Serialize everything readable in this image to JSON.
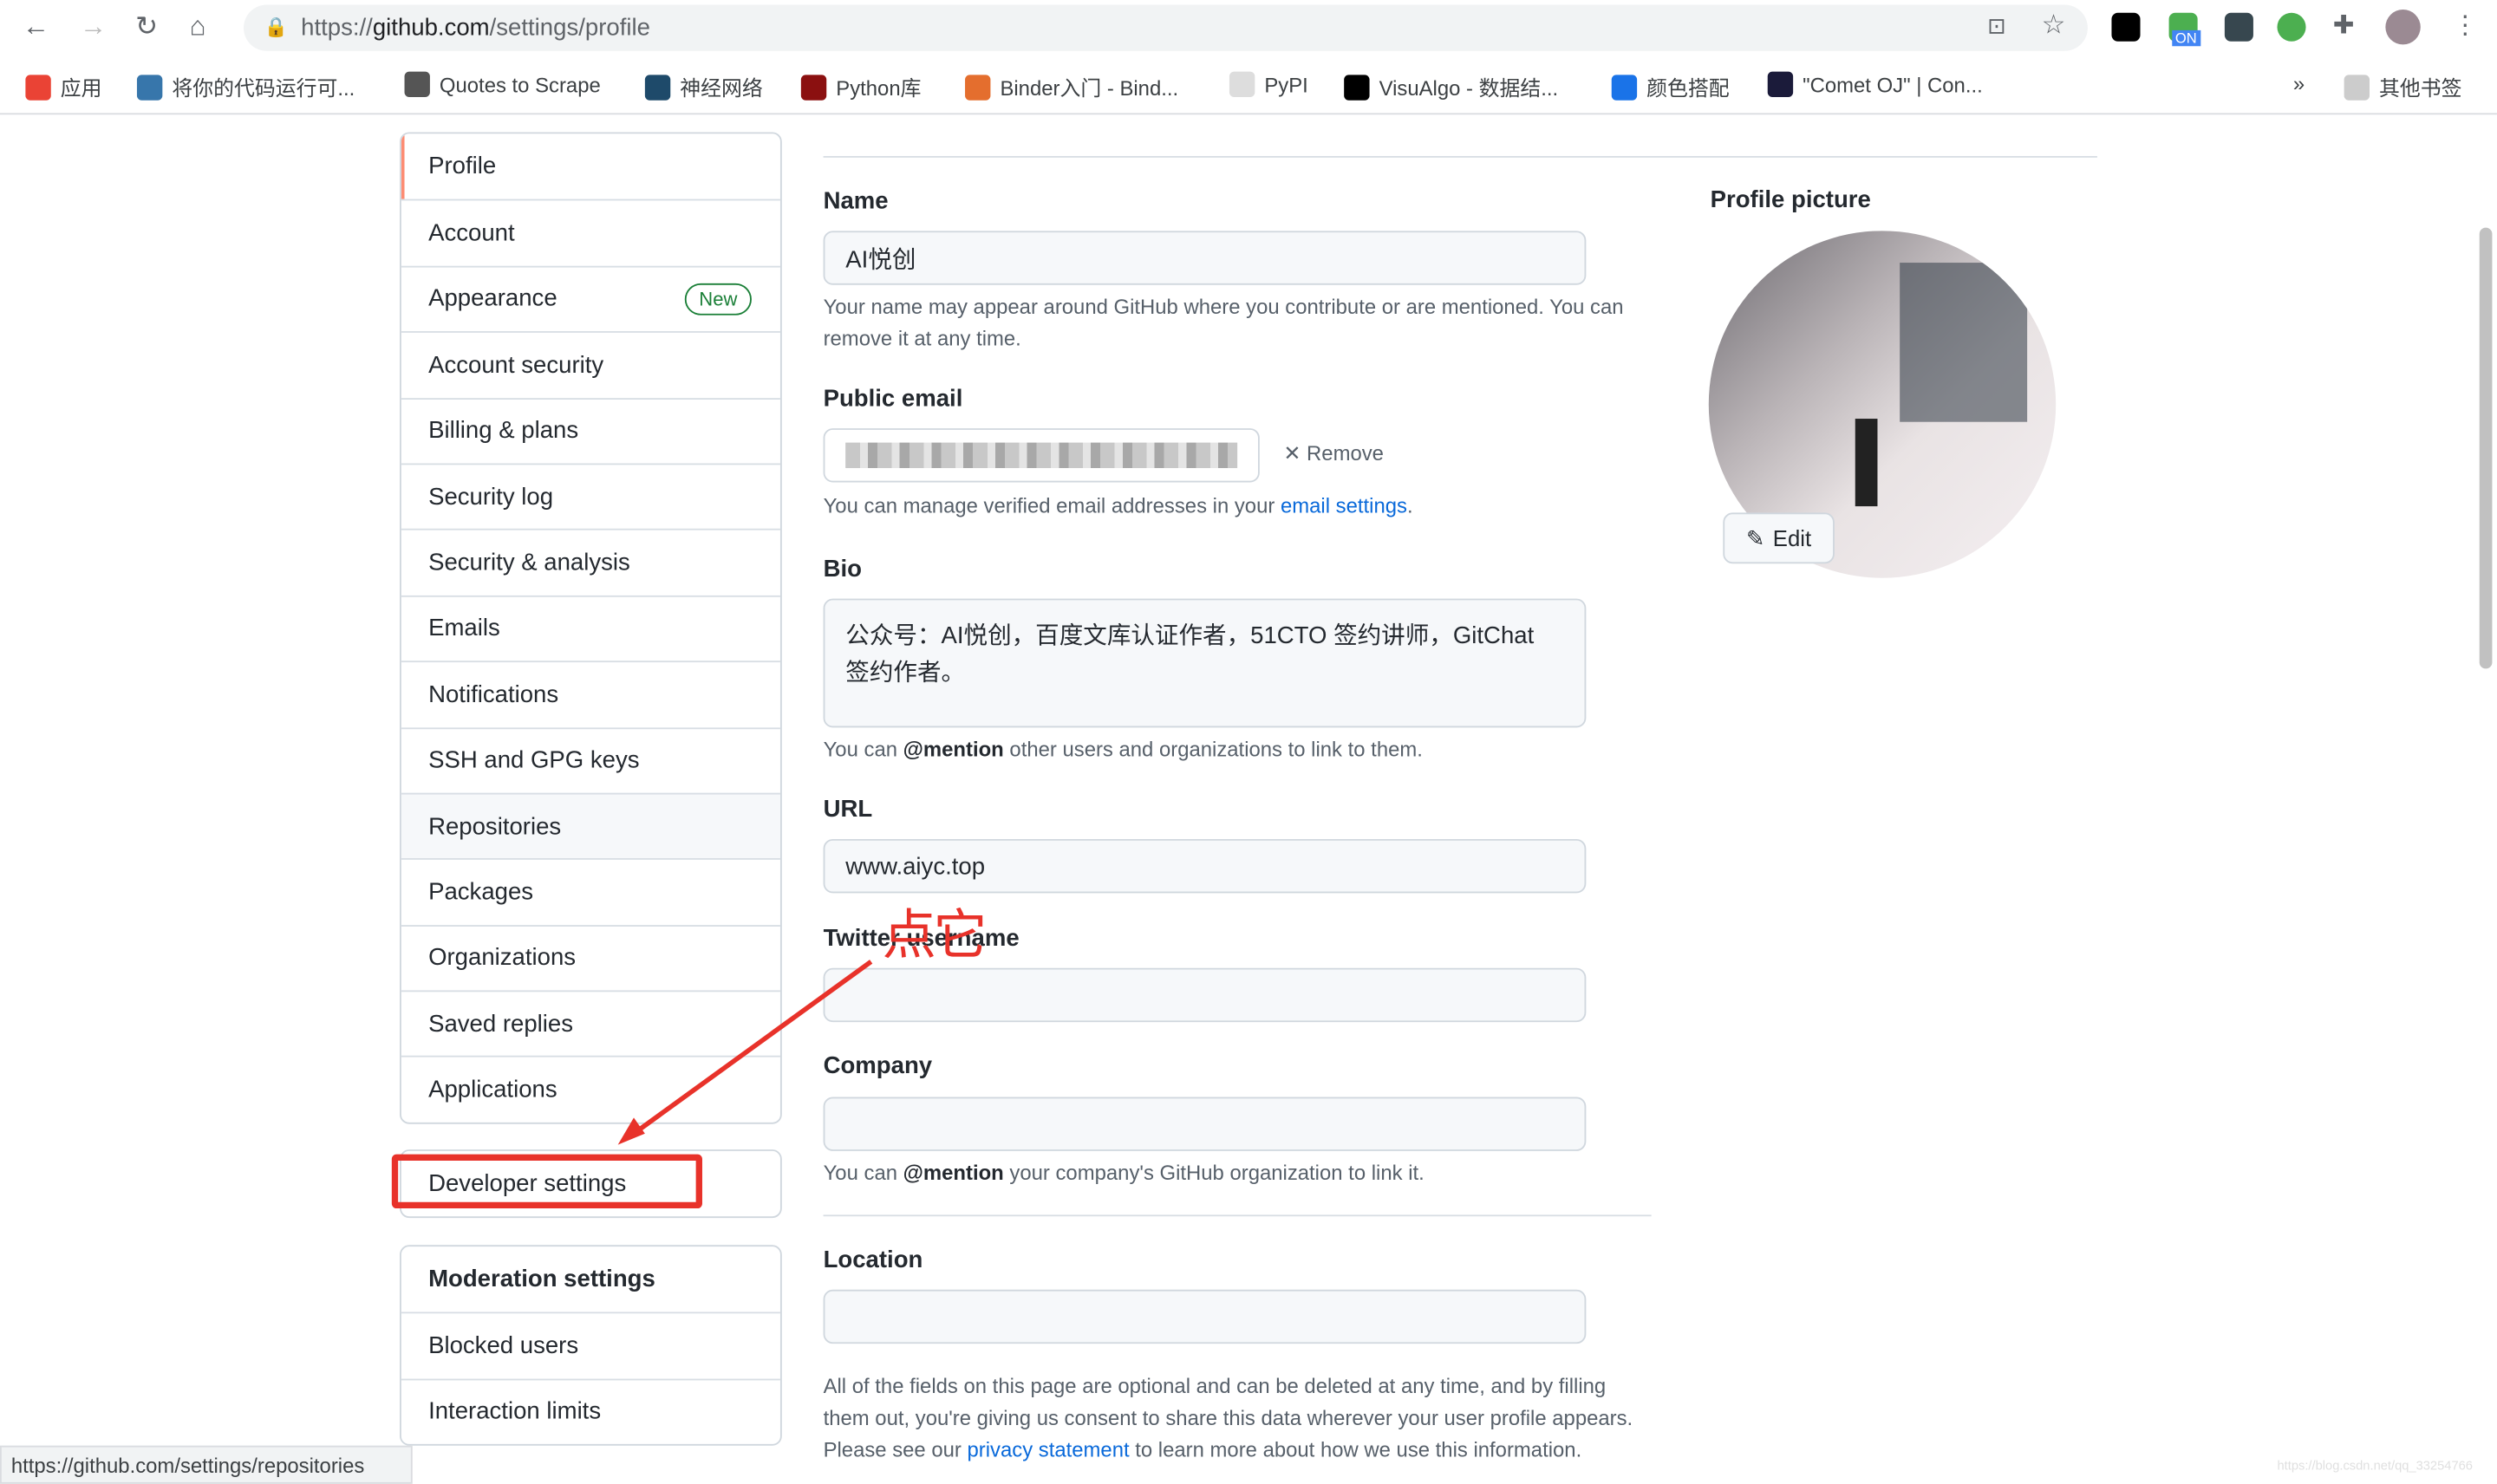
{
  "browser": {
    "url_prefix": "https://",
    "url_host": "github.com",
    "url_path": "/settings/profile",
    "bookmarks": [
      {
        "label": "应用",
        "color": "#ea4335"
      },
      {
        "label": "将你的代码运行可...",
        "color": "#3776ab"
      },
      {
        "label": "Quotes to Scrape",
        "color": "#555"
      },
      {
        "label": "神经网络",
        "color": "#1e4a6a"
      },
      {
        "label": "Python库",
        "color": "#8b1010"
      },
      {
        "label": "Binder入门 - Bind...",
        "color": "#e46e2e"
      },
      {
        "label": "PyPI",
        "color": "#ddd"
      },
      {
        "label": "VisuAlgo - 数据结...",
        "color": "#000"
      },
      {
        "label": "颜色搭配",
        "color": "#1a73e8"
      },
      {
        "label": "\"Comet OJ\" | Con...",
        "color": "#1b1b3a"
      }
    ],
    "more": "»",
    "other_bookmarks": "其他书签",
    "ext_badge": "ON"
  },
  "sidebar": {
    "items": [
      {
        "label": "Profile",
        "selected": true
      },
      {
        "label": "Account"
      },
      {
        "label": "Appearance",
        "badge": "New"
      },
      {
        "label": "Account security"
      },
      {
        "label": "Billing & plans"
      },
      {
        "label": "Security log"
      },
      {
        "label": "Security & analysis"
      },
      {
        "label": "Emails"
      },
      {
        "label": "Notifications"
      },
      {
        "label": "SSH and GPG keys"
      },
      {
        "label": "Repositories",
        "hover": true
      },
      {
        "label": "Packages"
      },
      {
        "label": "Organizations"
      },
      {
        "label": "Saved replies"
      },
      {
        "label": "Applications"
      }
    ],
    "developer": "Developer settings",
    "moderation": {
      "title": "Moderation settings",
      "items": [
        "Blocked users",
        "Interaction limits"
      ]
    }
  },
  "form": {
    "name": {
      "label": "Name",
      "value": "AI悦创",
      "help": "Your name may appear around GitHub where you contribute or are mentioned. You can remove it at any time."
    },
    "email": {
      "label": "Public email",
      "remove": "Remove",
      "help_pre": "You can manage verified email addresses in your ",
      "help_link": "email settings",
      "help_post": "."
    },
    "bio": {
      "label": "Bio",
      "value": "公众号：AI悦创，百度文库认证作者，51CTO 签约讲师，GitChat 签约作者。",
      "help_pre": "You can ",
      "help_bold": "@mention",
      "help_post": " other users and organizations to link to them."
    },
    "url": {
      "label": "URL",
      "value": "www.aiyc.top"
    },
    "twitter": {
      "label": "Twitter username",
      "value": ""
    },
    "company": {
      "label": "Company",
      "value": "",
      "help_pre": "You can ",
      "help_bold": "@mention",
      "help_post": " your company's GitHub organization to link it."
    },
    "location": {
      "label": "Location",
      "value": ""
    },
    "footer_pre": "All of the fields on this page are optional and can be deleted at any time, and by filling them out, you're giving us consent to share this data wherever your user profile appears. Please see our ",
    "footer_link": "privacy statement",
    "footer_post": " to learn more about how we use this information."
  },
  "picture": {
    "label": "Profile picture",
    "edit": "Edit"
  },
  "annotation": {
    "text": "点它",
    "color": "#e8322a"
  },
  "status_url": "https://github.com/settings/repositories",
  "watermark": "https://blog.csdn.net/qq_33254766"
}
